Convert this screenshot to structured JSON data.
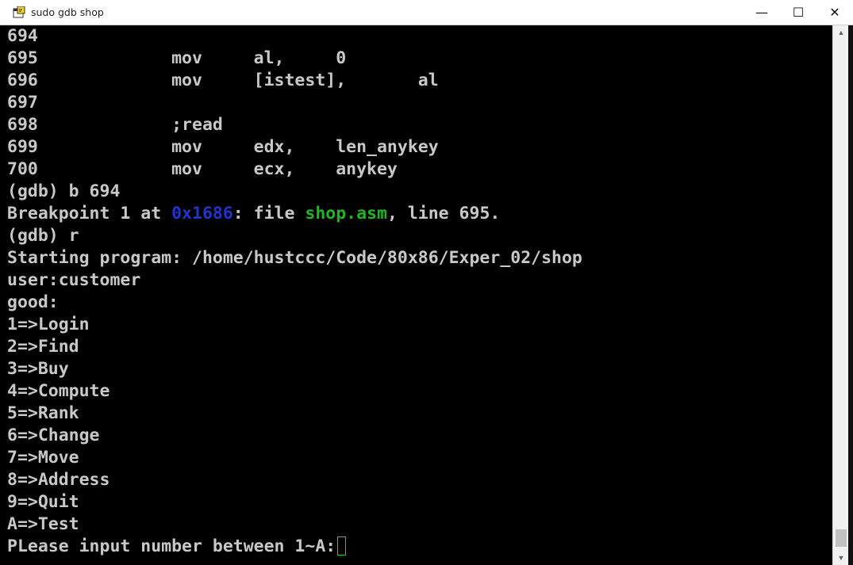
{
  "window": {
    "title": "sudo gdb shop",
    "controls": {
      "minimize": "—",
      "maximize": "☐",
      "close": "✕"
    }
  },
  "terminal": {
    "lines": [
      [
        {
          "text": "694"
        }
      ],
      [
        {
          "text": "695             mov     al,     0"
        }
      ],
      [
        {
          "text": "696             mov     [istest],       al"
        }
      ],
      [
        {
          "text": "697"
        }
      ],
      [
        {
          "text": "698             ;read"
        }
      ],
      [
        {
          "text": "699             mov     edx,    len_anykey"
        }
      ],
      [
        {
          "text": "700             mov     ecx,    anykey"
        }
      ],
      [
        {
          "text": "(gdb) b 694"
        }
      ],
      [
        {
          "text": "Breakpoint 1 at "
        },
        {
          "text": "0x1686",
          "style": "addr"
        },
        {
          "text": ": file "
        },
        {
          "text": "shop.asm",
          "style": "fname"
        },
        {
          "text": ", line 695."
        }
      ],
      [
        {
          "text": "(gdb) r"
        }
      ],
      [
        {
          "text": "Starting program: /home/hustccc/Code/80x86/Exper_02/shop"
        }
      ],
      [
        {
          "text": "user:customer"
        }
      ],
      [
        {
          "text": "good:"
        }
      ],
      [
        {
          "text": "1=>Login"
        }
      ],
      [
        {
          "text": "2=>Find"
        }
      ],
      [
        {
          "text": "3=>Buy"
        }
      ],
      [
        {
          "text": "4=>Compute"
        }
      ],
      [
        {
          "text": "5=>Rank"
        }
      ],
      [
        {
          "text": "6=>Change"
        }
      ],
      [
        {
          "text": "7=>Move"
        }
      ],
      [
        {
          "text": "8=>Address"
        }
      ],
      [
        {
          "text": "9=>Quit"
        }
      ],
      [
        {
          "text": "A=>Test"
        }
      ],
      [
        {
          "text": "PLease input number between 1~A:"
        }
      ]
    ],
    "cursor_line": 23
  },
  "colors": {
    "text": "#c8c8c8",
    "address": "#2233cc",
    "filename": "#22b422",
    "cursor": "#23d223",
    "background": "#000000"
  },
  "icons": {
    "app": "terminal-app-icon",
    "scroll_up": "scroll-up-arrow-icon",
    "scroll_down": "scroll-down-arrow-icon"
  }
}
